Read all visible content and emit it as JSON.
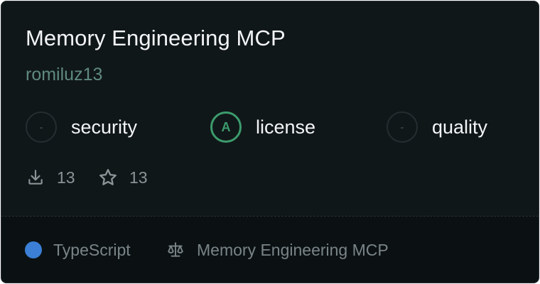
{
  "server": {
    "title": "Memory Engineering MCP",
    "author": "romiluz13"
  },
  "badges": [
    {
      "label": "security",
      "grade": "-"
    },
    {
      "label": "license",
      "grade": "A"
    },
    {
      "label": "quality",
      "grade": "-"
    }
  ],
  "stats": {
    "downloads": "13",
    "stars": "13"
  },
  "footer": {
    "language": "TypeScript",
    "language_color": "#3b7fd6",
    "license_name": "Memory Engineering MCP"
  },
  "icons": {
    "downloads": "download-icon",
    "stars": "star-icon",
    "license": "scale-icon"
  },
  "colors": {
    "grade_a": "#3c9b6c",
    "background": "#101719"
  }
}
